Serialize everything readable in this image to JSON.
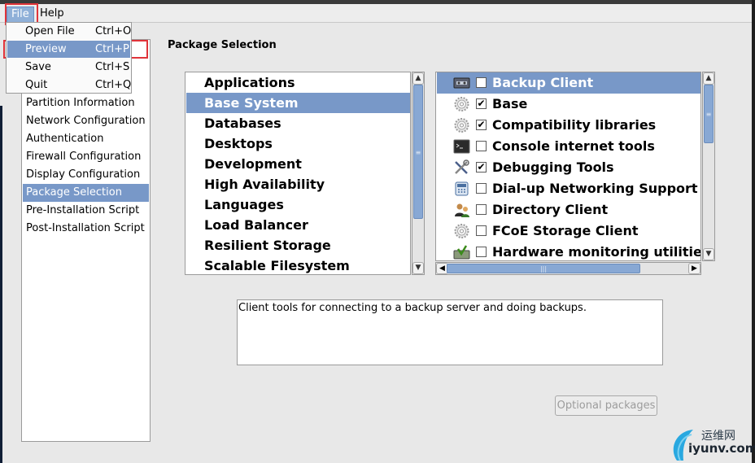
{
  "menubar": {
    "file": "File",
    "help": "Help"
  },
  "file_menu": [
    {
      "label": "Open File",
      "accel": "Ctrl+O"
    },
    {
      "label": "Preview",
      "accel": "Ctrl+P"
    },
    {
      "label": "Save",
      "accel": "Ctrl+S"
    },
    {
      "label": "Quit",
      "accel": "Ctrl+Q"
    }
  ],
  "nav": [
    "Partition Information",
    "Network Configuration",
    "Authentication",
    "Firewall Configuration",
    "Display Configuration",
    "Package Selection",
    "Pre-Installation Script",
    "Post-Installation Script"
  ],
  "selected_nav": "Package Selection",
  "page_title": "Package Selection",
  "categories": [
    "Applications",
    "Base System",
    "Databases",
    "Desktops",
    "Development",
    "High Availability",
    "Languages",
    "Load Balancer",
    "Resilient Storage",
    "Scalable Filesystem Support"
  ],
  "selected_category": "Base System",
  "packages": [
    {
      "name": "Backup Client",
      "checked": false,
      "icon": "tape-drive-icon"
    },
    {
      "name": "Base",
      "checked": true,
      "icon": "gear-icon"
    },
    {
      "name": "Compatibility libraries",
      "checked": true,
      "icon": "gear-icon"
    },
    {
      "name": "Console internet tools",
      "checked": false,
      "icon": "terminal-icon"
    },
    {
      "name": "Debugging Tools",
      "checked": true,
      "icon": "tools-icon"
    },
    {
      "name": "Dial-up Networking Support",
      "checked": false,
      "icon": "phone-icon"
    },
    {
      "name": "Directory Client",
      "checked": false,
      "icon": "directory-users-icon"
    },
    {
      "name": "FCoE Storage Client",
      "checked": false,
      "icon": "gear-icon"
    },
    {
      "name": "Hardware monitoring utilities",
      "checked": false,
      "icon": "hardware-monitor-icon"
    }
  ],
  "selected_package": "Backup Client",
  "description": "Client tools for connecting to a backup server and doing backups.",
  "optional_packages_button": "Optional packages",
  "watermark": {
    "line1": "运维网",
    "line2": "iyunv.com"
  },
  "colors": {
    "selection": "#7898c8",
    "highlight_box": "#e0343a"
  }
}
